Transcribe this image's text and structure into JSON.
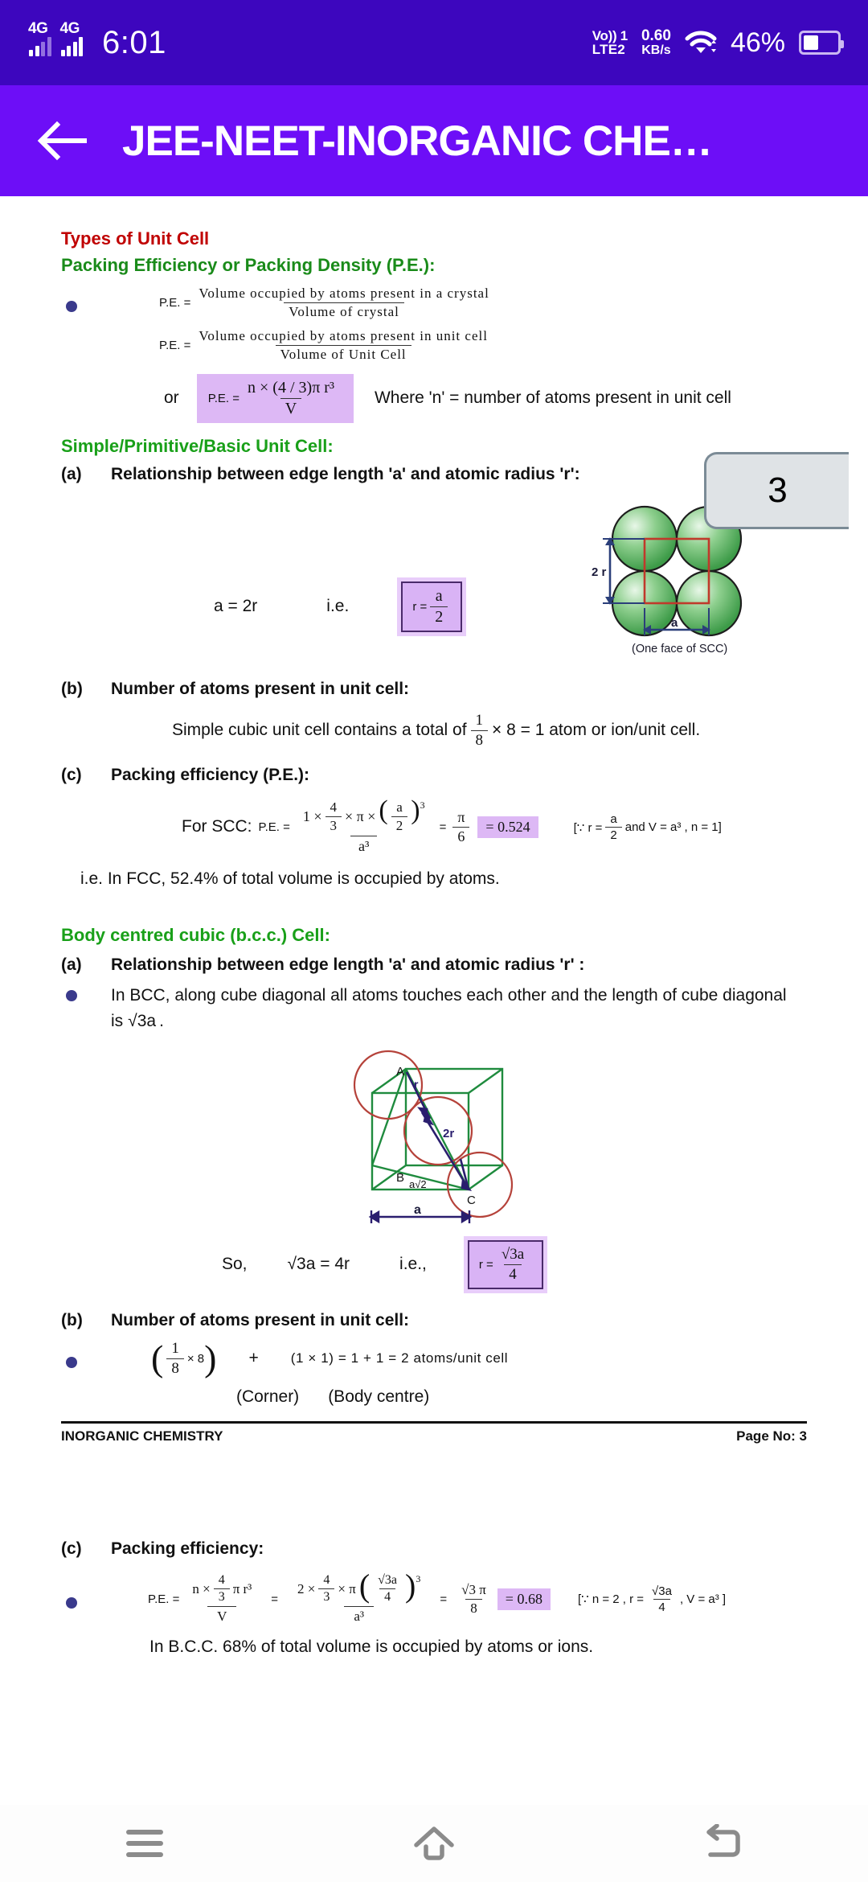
{
  "status_bar": {
    "network_1": "4G",
    "network_2": "4G",
    "time": "6:01",
    "volte_line1": "Vo)) 1",
    "volte_line2": "LTE2",
    "net_speed_value": "0.60",
    "net_speed_unit": "KB/s",
    "wifi_icon": "wifi-icon",
    "battery_percent": "46%"
  },
  "app_bar": {
    "back_icon": "back-arrow-icon",
    "title": "JEE-NEET-INORGANIC CHE…"
  },
  "page_indicator": {
    "value": "3"
  },
  "document": {
    "heading_red": "Types of Unit Cell",
    "heading_green": "Packing Efficiency or Packing Density (P.E.):",
    "pe_formula_1": {
      "label": "P.E. =",
      "numerator": "Volume occupied by atoms present in a crystal",
      "denominator": "Volume of crystal"
    },
    "pe_formula_2": {
      "label": "P.E. =",
      "numerator": "Volume occupied by atoms present in unit cell",
      "denominator": "Volume of Unit Cell"
    },
    "pe_formula_3": {
      "or": "or",
      "label": "P.E. =",
      "numerator": "n × (4 / 3)π r³",
      "denominator": "V",
      "note": "Where 'n' = number of atoms present in unit cell"
    },
    "scc": {
      "heading": "Simple/Primitive/Basic Unit Cell:",
      "a_label": "(a)",
      "a_text": "Relationship between edge length 'a' and atomic radius 'r':",
      "relation": "a = 2r",
      "ie": "i.e.",
      "boxed_r": "r =",
      "boxed_num": "a",
      "boxed_den": "2",
      "diagram_caption": "(One face of SCC)",
      "diagram_label_2r": "2 r",
      "diagram_label_a": "a",
      "b_label": "(b)",
      "b_text": "Number of atoms present in unit cell:",
      "b_sentence_pre": "Simple cubic unit cell contains a total of",
      "b_frac_num": "1",
      "b_frac_den": "8",
      "b_sentence_post": "× 8 = 1 atom or ion/unit cell.",
      "c_label": "(c)",
      "c_text": "Packing efficiency (P.E.):",
      "c_prefix": "For SCC:",
      "c_pe_label": "P.E. =",
      "c_num_lead": "1 ×",
      "c_num_frac_n": "4",
      "c_num_frac_d": "3",
      "c_num_mid": "× π ×",
      "c_paren_num": "a",
      "c_paren_den": "2",
      "c_paren_exp": "3",
      "c_den": "a³",
      "c_eq": "=",
      "c_res_num": "π",
      "c_res_den": "6",
      "c_highlight": "= 0.524",
      "c_condition_pre": "[∵ r =",
      "c_cond_num": "a",
      "c_cond_den": "2",
      "c_condition_post": "and V = a³ , n = 1]",
      "c_summary": "i.e. In FCC, 52.4% of total volume is occupied by atoms."
    },
    "bcc": {
      "heading": "Body centred cubic (b.c.c.) Cell:",
      "a_label": "(a)",
      "a_text": "Relationship between edge length 'a' and atomic radius 'r' :",
      "a_bullet_line1": "In BCC, along cube diagonal all atoms touches each other and the length of cube diagonal",
      "a_bullet_line2_pre": "is",
      "a_bullet_line2_rad": "√3a",
      "a_bullet_line2_post": ".",
      "diagram_label_A": "A",
      "diagram_label_B": "B",
      "diagram_label_C": "C",
      "diagram_label_r": "r",
      "diagram_label_2r": "2r",
      "diagram_label_asqrt2": "a√2",
      "diagram_label_a": "a",
      "so": "So,",
      "relation": "√3a = 4r",
      "ie": "i.e.,",
      "boxed_r": "r =",
      "boxed_num": "√3a",
      "boxed_den": "4",
      "b_label": "(b)",
      "b_text": "Number of atoms present in unit cell:",
      "b_frac_num": "1",
      "b_frac_den": "8",
      "b_frac_mul": "× 8",
      "b_plus": "+",
      "b_rest": "(1 × 1) = 1 + 1 = 2 atoms/unit cell",
      "b_sub1": "(Corner)",
      "b_sub2": "(Body centre)",
      "c_label": "(c)",
      "c_text": "Packing efficiency:",
      "c_pe_label": "P.E. =",
      "c_f1_num_lead": "n ×",
      "c_f1_num_frac_n": "4",
      "c_f1_num_frac_d": "3",
      "c_f1_num_tail": "π r³",
      "c_f1_den": "V",
      "c_eq1": "=",
      "c_f2_num_lead": "2 ×",
      "c_f2_num_frac_n": "4",
      "c_f2_num_frac_d": "3",
      "c_f2_num_mid": "× π",
      "c_f2_paren_num": "√3a",
      "c_f2_paren_den": "4",
      "c_f2_paren_exp": "3",
      "c_f2_den": "a³",
      "c_eq2": "=",
      "c_res_num": "√3 π",
      "c_res_den": "8",
      "c_highlight": "= 0.68",
      "c_condition_pre": "[∵ n = 2 , r =",
      "c_cond_num": "√3a",
      "c_cond_den": "4",
      "c_condition_post": ", V = a³ ]",
      "c_summary": "In B.C.C. 68% of total volume is occupied by atoms or ions."
    },
    "footer": {
      "left": "INORGANIC CHEMISTRY",
      "right": "Page No: 3"
    }
  },
  "nav_bar": {
    "recents_icon": "menu-icon",
    "home_icon": "home-icon",
    "back_icon": "back-icon"
  },
  "colors": {
    "status_bar": "#3d06be",
    "app_bar": "#6d0ef7",
    "heading_red": "#c00000",
    "heading_green": "#1a8b1a",
    "highlight": "#ddb8f5"
  }
}
